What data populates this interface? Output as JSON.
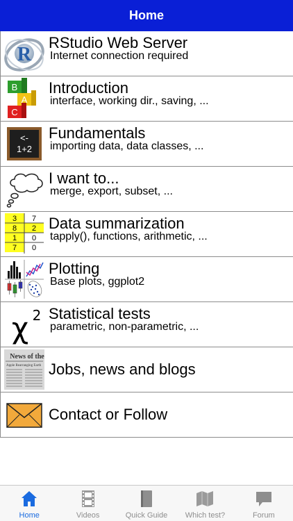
{
  "header": {
    "title": "Home"
  },
  "menu": [
    {
      "title": "RStudio Web Server",
      "subtitle": "Internet connection required",
      "icon": "r-logo-icon"
    },
    {
      "title": "Introduction",
      "subtitle": "interface, working dir., saving, ...",
      "icon": "abc-blocks-icon",
      "blocks": [
        "B",
        "A",
        "C"
      ]
    },
    {
      "title": "Fundamentals",
      "subtitle": "importing data, data classes, ...",
      "icon": "chalkboard-icon",
      "board": [
        "<-",
        "1+2"
      ]
    },
    {
      "title": "I want to...",
      "subtitle": "merge, export, subset, ...",
      "icon": "thought-bubble-icon"
    },
    {
      "title": "Data summarization",
      "subtitle": "tapply(), functions, arithmetic, ...",
      "icon": "table-icon",
      "table": [
        [
          "3",
          "7"
        ],
        [
          "8",
          "2"
        ],
        [
          "1",
          "0"
        ],
        [
          "7",
          "0"
        ]
      ]
    },
    {
      "title": "Plotting",
      "subtitle": "Base plots, ggplot2",
      "icon": "plots-icon"
    },
    {
      "title": "Statistical tests",
      "subtitle": "parametric, non-parametric, ...",
      "icon": "chi-squared-icon",
      "symbol": "χ",
      "superscript": "2"
    },
    {
      "title": "Jobs, news and blogs",
      "subtitle": "",
      "icon": "newspaper-icon",
      "paper": [
        "News of the",
        "Apple Rearranging Earth"
      ]
    },
    {
      "title": "Contact or Follow",
      "subtitle": "",
      "icon": "envelope-icon"
    }
  ],
  "tabs": [
    {
      "label": "Home",
      "icon": "home-icon",
      "active": true
    },
    {
      "label": "Videos",
      "icon": "film-icon",
      "active": false
    },
    {
      "label": "Quick Guide",
      "icon": "book-icon",
      "active": false
    },
    {
      "label": "Which test?",
      "icon": "map-icon",
      "active": false
    },
    {
      "label": "Forum",
      "icon": "chat-icon",
      "active": false
    }
  ],
  "colors": {
    "navbar": "#0a1fd6",
    "active_tab": "#1a6be0",
    "inactive_tab": "#8e8e8e"
  }
}
